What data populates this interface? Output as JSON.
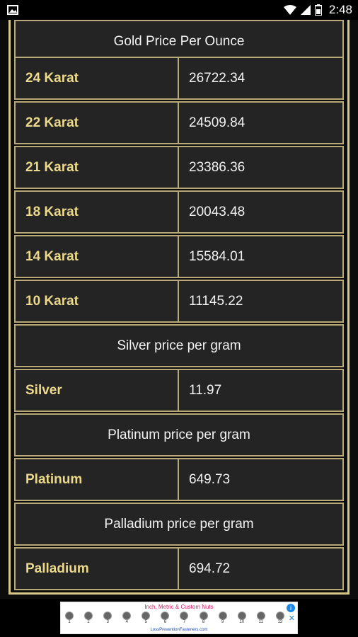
{
  "status_bar": {
    "time": "2:48"
  },
  "gold": {
    "header": "Gold Price Per Ounce",
    "rows": [
      {
        "label": "24 Karat",
        "value": "26722.34"
      },
      {
        "label": "22 Karat",
        "value": "24509.84"
      },
      {
        "label": "21 Karat",
        "value": "23386.36"
      },
      {
        "label": "18 Karat",
        "value": "20043.48"
      },
      {
        "label": "14 Karat",
        "value": "15584.01"
      },
      {
        "label": "10 Karat",
        "value": "11145.22"
      }
    ]
  },
  "silver": {
    "header": "Silver price per gram",
    "label": "Silver",
    "value": "11.97"
  },
  "platinum": {
    "header": "Platinum price per gram",
    "label": "Platinum",
    "value": "649.73"
  },
  "palladium": {
    "header": "Palladium price per gram",
    "label": "Palladium",
    "value": "694.72"
  },
  "ad": {
    "title": "Inch, Metric & Custom Nuts",
    "items": [
      "1",
      "2",
      "3",
      "4",
      "5",
      "6",
      "7",
      "8",
      "9",
      "10",
      "11",
      "12"
    ],
    "url": "LossPreventionFasteners.com"
  }
}
